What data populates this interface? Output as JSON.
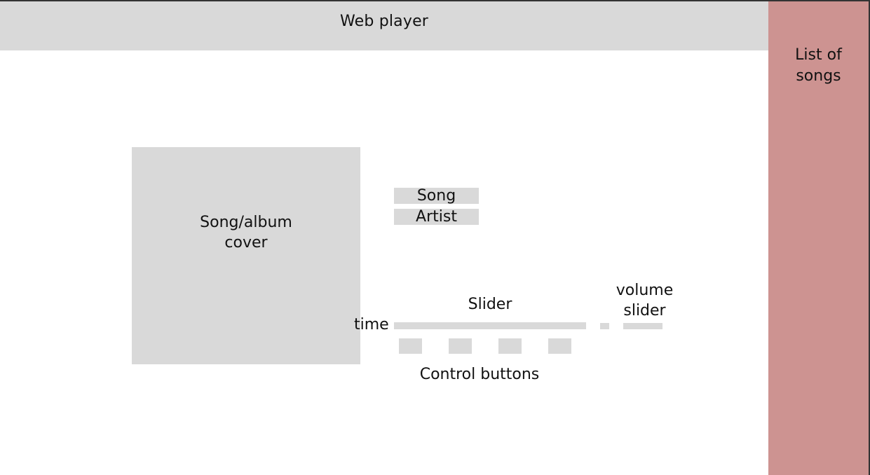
{
  "header": {
    "title": "Web player"
  },
  "sidebar": {
    "label": "List of\nsongs"
  },
  "cover": {
    "label": "Song/album\ncover"
  },
  "track": {
    "song": "Song",
    "artist": "Artist"
  },
  "playback": {
    "time_label": "time",
    "slider_label": "Slider",
    "volume_label": "volume\nslider",
    "controls_label": "Control buttons"
  },
  "colors": {
    "placeholder_gray": "#d9d9d9",
    "sidebar_accent": "#cd9391"
  }
}
